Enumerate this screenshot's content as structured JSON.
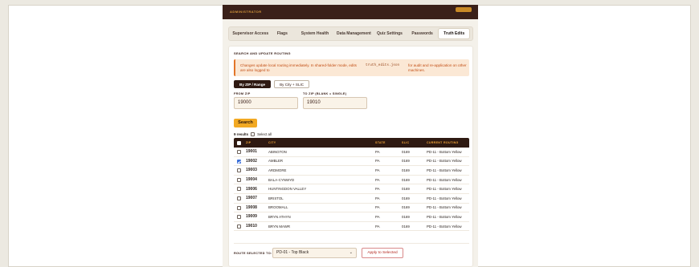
{
  "header": {
    "title": "ADMINISTRATOR"
  },
  "tabs": [
    {
      "label": "Supervisor Access",
      "active": false
    },
    {
      "label": "Flags",
      "active": false
    },
    {
      "label": "System Health",
      "active": false
    },
    {
      "label": "Data Management",
      "active": false
    },
    {
      "label": "Quiz Settings",
      "active": false
    },
    {
      "label": "Passwords",
      "active": false
    },
    {
      "label": "Truth Edits",
      "active": true
    }
  ],
  "section": {
    "title": "SEARCH AND UPDATE ROUTING",
    "notice_text_a": "Changes update local routing immediately. In shared-folder mode, edits are also logged to",
    "notice_code": "truth_edits.json",
    "notice_text_b": "for audit and re-application on other machines."
  },
  "modes": {
    "zip_range": "By ZIP / Range",
    "city_slic": "By City + SLIC"
  },
  "form": {
    "from_zip_label": "FROM ZIP",
    "from_zip_value": "19000",
    "to_zip_label": "TO ZIP (BLANK = SINGLE)",
    "to_zip_value": "19010",
    "search_label": "Search"
  },
  "results": {
    "count_label": "9 results",
    "select_all_label": "Select all"
  },
  "table": {
    "headers": {
      "zip": "ZIP",
      "city": "CITY",
      "state": "STATE",
      "slic": "SLIC",
      "routing": "CURRENT ROUTING"
    },
    "rows": [
      {
        "zip": "19001",
        "city": "ABINGTON",
        "state": "PA",
        "slic": "0169",
        "routing": "PD-11 - Bottom Yellow",
        "checked": false
      },
      {
        "zip": "19002",
        "city": "AMBLER",
        "state": "PA",
        "slic": "0169",
        "routing": "PD-11 - Bottom Yellow",
        "checked": true
      },
      {
        "zip": "19003",
        "city": "ARDMORE",
        "state": "PA",
        "slic": "0169",
        "routing": "PD-11 - Bottom Yellow",
        "checked": false
      },
      {
        "zip": "19004",
        "city": "BALA-CYNWYD",
        "state": "PA",
        "slic": "0169",
        "routing": "PD-11 - Bottom Yellow",
        "checked": false
      },
      {
        "zip": "19006",
        "city": "HUNTINGDON VALLEY",
        "state": "PA",
        "slic": "0169",
        "routing": "PD-11 - Bottom Yellow",
        "checked": false
      },
      {
        "zip": "19007",
        "city": "BRISTOL",
        "state": "PA",
        "slic": "0169",
        "routing": "PD-11 - Bottom Yellow",
        "checked": false
      },
      {
        "zip": "19008",
        "city": "BROOMALL",
        "state": "PA",
        "slic": "0169",
        "routing": "PD-11 - Bottom Yellow",
        "checked": false
      },
      {
        "zip": "19009",
        "city": "BRYN ATHYN",
        "state": "PA",
        "slic": "0169",
        "routing": "PD-11 - Bottom Yellow",
        "checked": false
      },
      {
        "zip": "19010",
        "city": "BRYN MAWR",
        "state": "PA",
        "slic": "0169",
        "routing": "PD-11 - Bottom Yellow",
        "checked": false
      }
    ]
  },
  "route": {
    "label": "ROUTE SELECTED TO:",
    "selected": "PD-01 - Top Black",
    "apply_label": "Apply to Selected"
  },
  "colors": {
    "brand_dark": "#2f1a12",
    "accent": "#f2a923",
    "notice": "#c24e14",
    "danger": "#b3261e"
  }
}
